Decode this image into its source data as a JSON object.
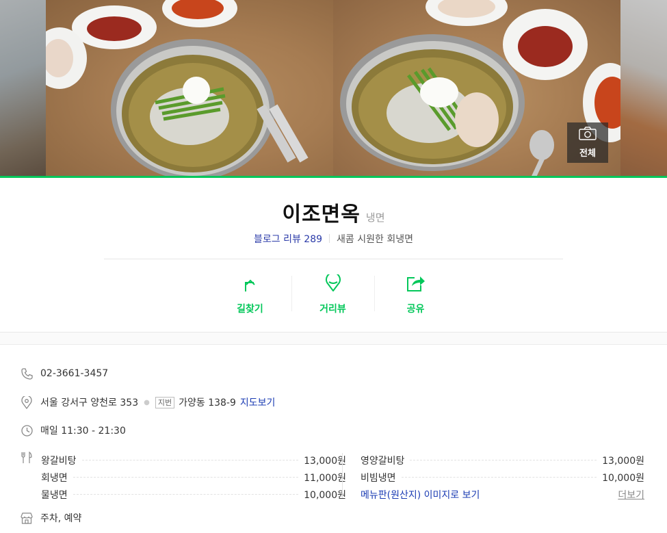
{
  "photos": {
    "all_label": "전체"
  },
  "place": {
    "name": "이조면옥",
    "category": "냉면",
    "review_label": "블로그 리뷰 289",
    "description": "새콤 시원한 회냉면"
  },
  "actions": [
    {
      "label": "길찾기",
      "icon": "directions-icon"
    },
    {
      "label": "거리뷰",
      "icon": "street-view-icon"
    },
    {
      "label": "공유",
      "icon": "share-icon"
    }
  ],
  "info": {
    "phone": "02-3661-3457",
    "address": "서울 강서구 양천로 353",
    "jibun_badge": "지번",
    "jibun_address": "가양동 138-9",
    "map_link": "지도보기",
    "hours": "매일 11:30 - 21:30",
    "facilities": "주차, 예약"
  },
  "menu": {
    "left": [
      {
        "name": "왕갈비탕",
        "price": "13,000원"
      },
      {
        "name": "회냉면",
        "price": "11,000원"
      },
      {
        "name": "물냉면",
        "price": "10,000원"
      }
    ],
    "right": [
      {
        "name": "영양갈비탕",
        "price": "13,000원"
      },
      {
        "name": "비빔냉면",
        "price": "10,000원"
      }
    ],
    "menu_board_link": "메뉴판(원산지) 이미지로 보기",
    "more_label": "더보기"
  },
  "colors": {
    "accent": "#03c75a",
    "link": "#1a3bb3"
  }
}
